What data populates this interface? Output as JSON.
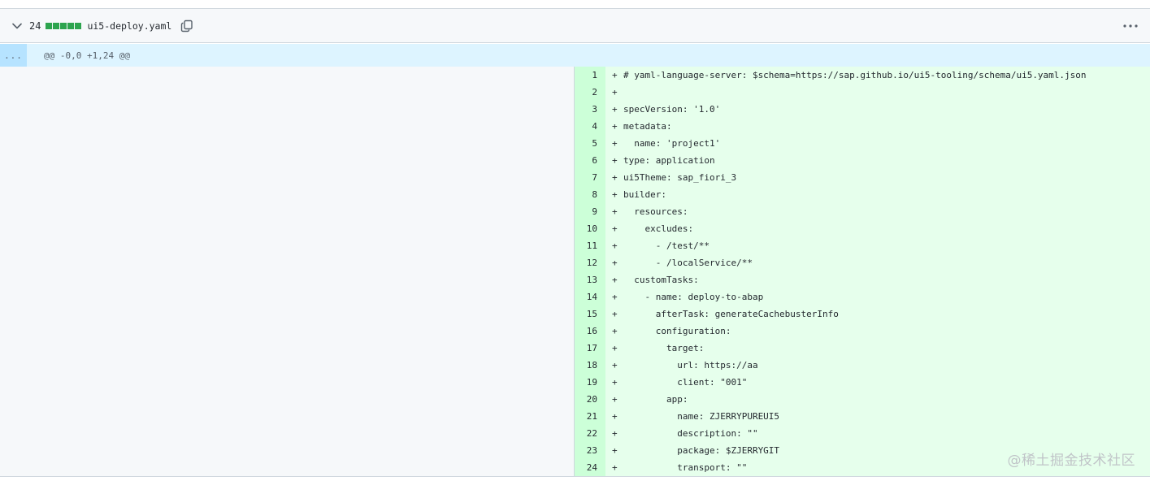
{
  "file": {
    "line_count": "24",
    "diffstat_blocks": 5,
    "name": "ui5-deploy.yaml",
    "icons": [
      "chevron-down-icon",
      "copy-icon",
      "kebab-horizontal-icon"
    ]
  },
  "hunk": {
    "expand_label": "...",
    "header": "@@ -0,0 +1,24 @@"
  },
  "lines": [
    {
      "num": "1",
      "marker": "+",
      "code": "# yaml-language-server: $schema=https://sap.github.io/ui5-tooling/schema/ui5.yaml.json"
    },
    {
      "num": "2",
      "marker": "+",
      "code": ""
    },
    {
      "num": "3",
      "marker": "+",
      "code": "specVersion: '1.0'"
    },
    {
      "num": "4",
      "marker": "+",
      "code": "metadata:"
    },
    {
      "num": "5",
      "marker": "+",
      "code": "  name: 'project1'"
    },
    {
      "num": "6",
      "marker": "+",
      "code": "type: application"
    },
    {
      "num": "7",
      "marker": "+",
      "code": "ui5Theme: sap_fiori_3"
    },
    {
      "num": "8",
      "marker": "+",
      "code": "builder:"
    },
    {
      "num": "9",
      "marker": "+",
      "code": "  resources:"
    },
    {
      "num": "10",
      "marker": "+",
      "code": "    excludes:"
    },
    {
      "num": "11",
      "marker": "+",
      "code": "      - /test/**"
    },
    {
      "num": "12",
      "marker": "+",
      "code": "      - /localService/**"
    },
    {
      "num": "13",
      "marker": "+",
      "code": "  customTasks:"
    },
    {
      "num": "14",
      "marker": "+",
      "code": "    - name: deploy-to-abap"
    },
    {
      "num": "15",
      "marker": "+",
      "code": "      afterTask: generateCachebusterInfo"
    },
    {
      "num": "16",
      "marker": "+",
      "code": "      configuration:"
    },
    {
      "num": "17",
      "marker": "+",
      "code": "        target:"
    },
    {
      "num": "18",
      "marker": "+",
      "code": "          url: https://aa"
    },
    {
      "num": "19",
      "marker": "+",
      "code": "          client: \"001\""
    },
    {
      "num": "20",
      "marker": "+",
      "code": "        app:"
    },
    {
      "num": "21",
      "marker": "+",
      "code": "          name: ZJERRYPUREUI5"
    },
    {
      "num": "22",
      "marker": "+",
      "code": "          description: \"\""
    },
    {
      "num": "23",
      "marker": "+",
      "code": "          package: $ZJERRYGIT"
    },
    {
      "num": "24",
      "marker": "+",
      "code": "          transport: \"\""
    }
  ],
  "watermark": "@稀土掘金技术社区",
  "colors": {
    "addition_bg": "#e6ffec",
    "addition_gutter": "#ccffd8",
    "hunk_bg": "#ddf4ff",
    "diffstat_green": "#2da44e"
  }
}
